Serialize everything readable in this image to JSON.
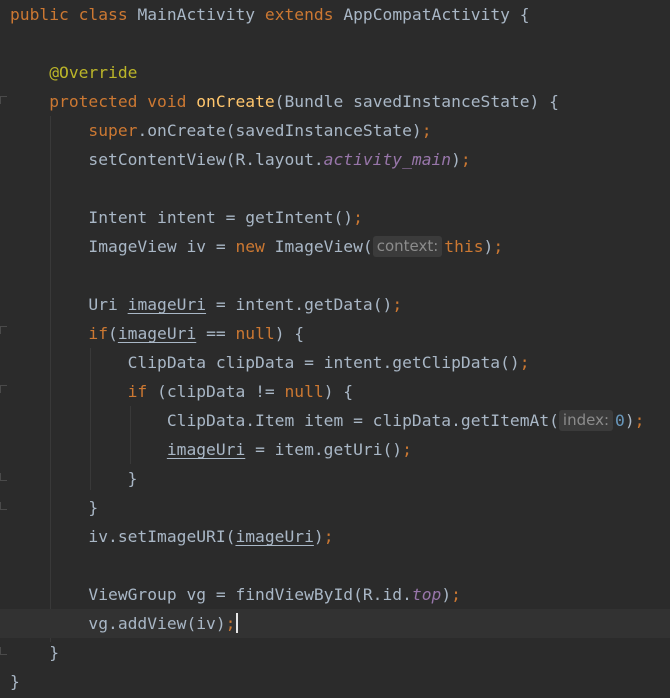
{
  "editor": {
    "lines": [
      [
        [
          "kw",
          "public "
        ],
        [
          "kw",
          "class "
        ],
        [
          "plain",
          "MainActivity "
        ],
        [
          "kw",
          "extends "
        ],
        [
          "plain",
          "AppCompatActivity {"
        ]
      ],
      [],
      [
        [
          "ann",
          "    @Override"
        ]
      ],
      [
        [
          "kw",
          "    protected "
        ],
        [
          "kw",
          "void "
        ],
        [
          "fn",
          "onCreate"
        ],
        [
          "plain",
          "(Bundle savedInstanceState) {"
        ]
      ],
      [
        [
          "kw",
          "        super"
        ],
        [
          "plain",
          ".onCreate(savedInstanceState)"
        ],
        [
          "kw",
          ";"
        ]
      ],
      [
        [
          "plain",
          "        setContentView(R.layout."
        ],
        [
          "field",
          "activity_main"
        ],
        [
          "plain",
          ")"
        ],
        [
          "kw",
          ";"
        ]
      ],
      [],
      [
        [
          "plain",
          "        Intent intent = getIntent()"
        ],
        [
          "kw",
          ";"
        ]
      ],
      [
        [
          "plain",
          "        ImageView iv = "
        ],
        [
          "kw",
          "new "
        ],
        [
          "plain",
          "ImageView("
        ],
        [
          "hint",
          "context:"
        ],
        [
          "kw",
          "this"
        ],
        [
          "plain",
          ")"
        ],
        [
          "kw",
          ";"
        ]
      ],
      [],
      [
        [
          "plain",
          "        Uri "
        ],
        [
          "ul",
          "imageUri"
        ],
        [
          "plain",
          " = intent.getData()"
        ],
        [
          "kw",
          ";"
        ]
      ],
      [
        [
          "kw",
          "        if"
        ],
        [
          "plain",
          "("
        ],
        [
          "ul",
          "imageUri"
        ],
        [
          "plain",
          " == "
        ],
        [
          "kw",
          "null"
        ],
        [
          "plain",
          ") {"
        ]
      ],
      [
        [
          "plain",
          "            ClipData clipData = intent.getClipData()"
        ],
        [
          "kw",
          ";"
        ]
      ],
      [
        [
          "kw",
          "            if "
        ],
        [
          "plain",
          "(clipData != "
        ],
        [
          "kw",
          "null"
        ],
        [
          "plain",
          ") {"
        ]
      ],
      [
        [
          "plain",
          "                ClipData.Item item = clipData.getItemAt("
        ],
        [
          "hint",
          "index:"
        ],
        [
          "num",
          "0"
        ],
        [
          "plain",
          ")"
        ],
        [
          "kw",
          ";"
        ]
      ],
      [
        [
          "plain",
          "                "
        ],
        [
          "ul",
          "imageUri"
        ],
        [
          "plain",
          " = item.getUri()"
        ],
        [
          "kw",
          ";"
        ]
      ],
      [
        [
          "plain",
          "            }"
        ]
      ],
      [
        [
          "plain",
          "        }"
        ]
      ],
      [
        [
          "plain",
          "        iv.setImageURI("
        ],
        [
          "ul",
          "imageUri"
        ],
        [
          "plain",
          ")"
        ],
        [
          "kw",
          ";"
        ]
      ],
      [],
      [
        [
          "plain",
          "        ViewGroup vg = findViewById(R.id."
        ],
        [
          "field",
          "top"
        ],
        [
          "plain",
          ")"
        ],
        [
          "kw",
          ";"
        ]
      ],
      [
        [
          "plain",
          "        vg.addView(iv)"
        ],
        [
          "kw",
          ";"
        ],
        [
          "caret",
          ""
        ]
      ],
      [
        [
          "plain",
          "    }"
        ]
      ],
      [
        [
          "plain",
          "}"
        ]
      ]
    ]
  }
}
